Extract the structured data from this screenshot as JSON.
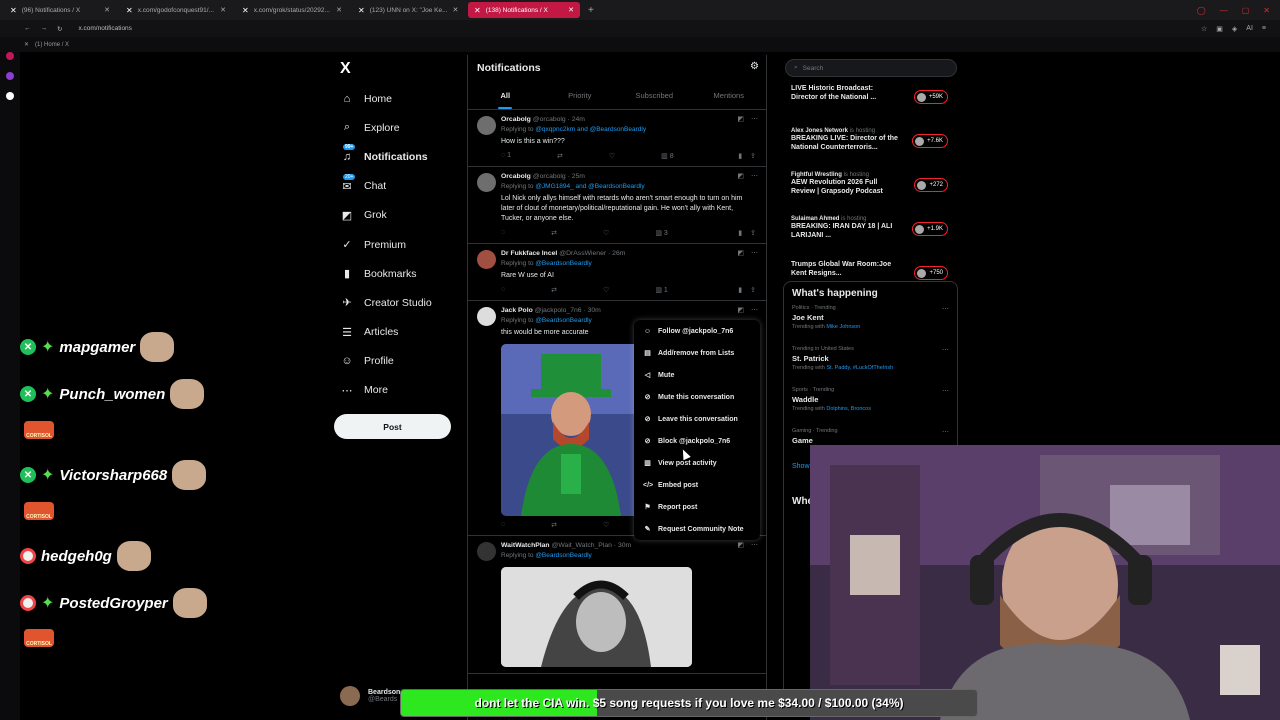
{
  "browser": {
    "tabs": [
      {
        "label": "(96) Notifications / X",
        "active": false
      },
      {
        "label": "x.com/godofconquest91/...",
        "active": false
      },
      {
        "label": "x.com/grok/status/20292...",
        "active": false
      },
      {
        "label": "(123) UNN on X: \"Joe Ke...",
        "active": false
      },
      {
        "label": "(138) Notifications / X",
        "active": true
      }
    ],
    "new_tab": "+",
    "url": "x.com/notifications",
    "bookmark": "(1) Home / X"
  },
  "nav": {
    "logo": "X",
    "items": [
      {
        "label": "Home",
        "icon": "home-icon",
        "glyph": "⌂"
      },
      {
        "label": "Explore",
        "icon": "search-icon",
        "glyph": "⌕"
      },
      {
        "label": "Notifications",
        "icon": "bell-icon",
        "glyph": "♫",
        "badge": "99+"
      },
      {
        "label": "Chat",
        "icon": "chat-icon",
        "glyph": "✉",
        "badge": "20+"
      },
      {
        "label": "Grok",
        "icon": "grok-icon",
        "glyph": "◩"
      },
      {
        "label": "Premium",
        "icon": "premium-icon",
        "glyph": "✓"
      },
      {
        "label": "Bookmarks",
        "icon": "bookmark-icon",
        "glyph": "▮"
      },
      {
        "label": "Creator Studio",
        "icon": "rocket-icon",
        "glyph": "✈"
      },
      {
        "label": "Articles",
        "icon": "articles-icon",
        "glyph": "☰"
      },
      {
        "label": "Profile",
        "icon": "profile-icon",
        "glyph": "☺"
      },
      {
        "label": "More",
        "icon": "more-icon",
        "glyph": "⋯"
      }
    ],
    "post_button": "Post",
    "profile_name": "Beardson",
    "profile_handle": "@Beards"
  },
  "notifications": {
    "title": "Notifications",
    "tabs": [
      "All",
      "Priority",
      "Subscribed",
      "Mentions"
    ],
    "posts": [
      {
        "name": "Orcabolg",
        "handle": "@orcabolg · 24m",
        "reply_prefix": "Replying to ",
        "reply_to": "@qxqpnc2km and @BeardsonBeardly",
        "text": "How is this a win???",
        "replies": "1",
        "views": "8",
        "avatar_color": "#6e6e6e"
      },
      {
        "name": "Orcabolg",
        "handle": "@orcabolg · 25m",
        "reply_prefix": "Replying to ",
        "reply_to": "@JMG1894_ and @BeardsonBeardly",
        "text": "Lol Nick only allys himself with retards who aren't smart enough to turn on him later of clout of monetary/political/reputational gain. He won't ally with Kent, Tucker, or anyone else.",
        "replies": "",
        "views": "3",
        "avatar_color": "#6e6e6e"
      },
      {
        "name": "Dr Fukkface Incel",
        "handle": "@DrAssWiener · 26m",
        "reply_prefix": "Replying to ",
        "reply_to": "@BeardsonBeardly",
        "text": "Rare W use of AI",
        "replies": "",
        "views": "1",
        "avatar_color": "#a05040"
      },
      {
        "name": "Jack Polo",
        "handle": "@jackpolo_7n6 · 30m",
        "reply_prefix": "Replying to ",
        "reply_to": "@BeardsonBeardly",
        "text": "this would be more accurate",
        "replies": "",
        "views": "",
        "avatar_color": "#dddddd"
      },
      {
        "name": "WaitWatchPlan",
        "handle": "@Wait_Watch_Plan · 30m",
        "reply_prefix": "Replying to ",
        "reply_to": "@BeardsonBeardly",
        "text": "",
        "replies": "",
        "views": "",
        "avatar_color": "#333333"
      }
    ]
  },
  "dropdown": {
    "items": [
      {
        "label": "Follow @jackpolo_7n6",
        "icon": "follow-icon",
        "glyph": "☺"
      },
      {
        "label": "Add/remove from Lists",
        "icon": "list-icon",
        "glyph": "▤"
      },
      {
        "label": "Mute",
        "icon": "mute-icon",
        "glyph": "◁"
      },
      {
        "label": "Mute this conversation",
        "icon": "mute-conversation-icon",
        "glyph": "⊘"
      },
      {
        "label": "Leave this conversation",
        "icon": "leave-icon",
        "glyph": "⊘"
      },
      {
        "label": "Block @jackpolo_7n6",
        "icon": "block-icon",
        "glyph": "⊘"
      },
      {
        "label": "View post activity",
        "icon": "activity-icon",
        "glyph": "▥"
      },
      {
        "label": "Embed post",
        "icon": "embed-icon",
        "glyph": "</>"
      },
      {
        "label": "Report post",
        "icon": "flag-icon",
        "glyph": "⚑"
      },
      {
        "label": "Request Community Note",
        "icon": "community-note-icon",
        "glyph": "✎"
      }
    ]
  },
  "right": {
    "search_placeholder": "Search",
    "live": [
      {
        "host": "",
        "hosting": "",
        "title": "LIVE Historic Broadcast: Director of the National ...",
        "count": "+59K"
      },
      {
        "host": "Alex Jones Network",
        "hosting": "is hosting",
        "title": "BREAKING LIVE: Director of the National Counterterroris...",
        "count": "+7.6K"
      },
      {
        "host": "Fightful Wrestling",
        "hosting": "is hosting",
        "title": "AEW Revolution 2026 Full Review | Grapsody Podcast",
        "count": "+272"
      },
      {
        "host": "Sulaiman Ahmed",
        "hosting": "is hosting",
        "title": "BREAKING: IRAN DAY 18 | ALI LARIJANI ...",
        "count": "+1.9K"
      },
      {
        "host": "",
        "hosting": "",
        "title": "Trumps Global War Room:Joe Kent Resigns...",
        "count": "+750"
      }
    ],
    "happening_title": "What's happening",
    "trends": [
      {
        "meta": "Politics · Trending",
        "name": "Joe Kent",
        "sub_prefix": "Trending with ",
        "sub_link": "Mike Johnson"
      },
      {
        "meta": "Trending in United States",
        "name": "St. Patrick",
        "sub_prefix": "Trending with ",
        "sub_link": "St. Paddy, #LuckOfTheIrish"
      },
      {
        "meta": "Sports · Trending",
        "name": "Waddle",
        "sub_prefix": "Trending with ",
        "sub_link": "Dolphins, Broncos"
      },
      {
        "meta": "Gaming · Trending",
        "name": "Game",
        "sub_prefix": "",
        "sub_link": ""
      }
    ],
    "show_more": "Show",
    "who_to_follow": "Whe"
  },
  "chat": [
    {
      "name": "mapgamer",
      "badge": "x"
    },
    {
      "name": "Punch_women",
      "badge": "x"
    },
    {
      "name": "Victorsharp668",
      "badge": "x"
    },
    {
      "name": "hedgeh0g",
      "badge": "dot"
    },
    {
      "name": "PostedGroyper",
      "badge": "dot"
    }
  ],
  "fire_badge_text": "CORTISOL",
  "donation": {
    "text": "dont let the CIA win. $5 song requests if you love me $34.00 / $100.00 (34%)",
    "progress": 0.34,
    "color": "#2ee81f"
  }
}
